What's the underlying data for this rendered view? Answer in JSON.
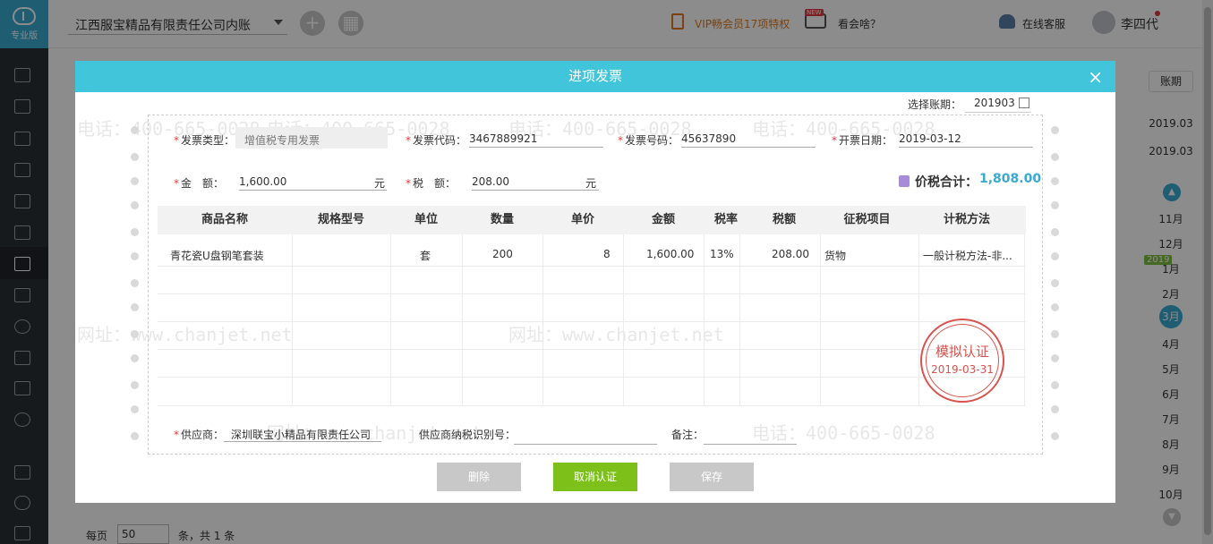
{
  "sidebar": {
    "logo_label": "专业版"
  },
  "header": {
    "company": "江西服宝精品有限责任公司内账",
    "vip": "VIP畅会员17项特权",
    "tv_badge": "NEW",
    "whats_on": "看会啥？",
    "service": "在线客服",
    "user": "李四代"
  },
  "period": {
    "title": "账期",
    "dates": [
      "2019.03",
      "2019.03"
    ],
    "months": [
      "11月",
      "12月",
      "1月",
      "2月",
      "3月",
      "4月",
      "5月",
      "6月",
      "7月",
      "8月",
      "9月",
      "10月"
    ],
    "year": "2019",
    "current_month": "3月"
  },
  "pager": {
    "per_page_label": "每页",
    "per_page": "50",
    "total": "条，共 1 条"
  },
  "watermark": {
    "phone": "电话：400-665-0028",
    "site": "网址：www.chanjet.net"
  },
  "modal": {
    "title": "进项发票",
    "close": "×",
    "account_period_label": "选择账期：",
    "account_period": "201903",
    "fields": {
      "invoice_type_label": "发票类型：",
      "invoice_type": "增值税专用发票",
      "invoice_code_label": "发票代码：",
      "invoice_code": "3467889921",
      "invoice_no_label": "发票号码：",
      "invoice_no": "45637890",
      "issue_date_label": "开票日期：",
      "issue_date": "2019-03-12",
      "amount_label": "金　额：",
      "amount": "1,600.00",
      "tax_label": "税　额：",
      "tax": "208.00",
      "unit": "元",
      "total_label": "价税合计：",
      "total": "1,808.00"
    },
    "table": {
      "headers": [
        "商品名称",
        "规格型号",
        "单位",
        "数量",
        "单价",
        "金额",
        "税率",
        "税额",
        "征税项目",
        "计税方法"
      ],
      "rows": [
        [
          "青花瓷U盘钢笔套装",
          "",
          "套",
          "200",
          "8",
          "1,600.00",
          "13%",
          "208.00",
          "货物",
          "一般计税方法-非..."
        ]
      ]
    },
    "stamp": {
      "text": "模拟认证",
      "date": "2019-03-31"
    },
    "supplier_label": "供应商：",
    "supplier": "深圳联宝小精品有限责任公司",
    "supplier_tax_label": "供应商纳税识别号：",
    "supplier_tax": "",
    "remark_label": "备注：",
    "remark": "",
    "buttons": {
      "delete": "删除",
      "cancel_cert": "取消认证",
      "save": "保存"
    }
  },
  "colors": {
    "header": "#40c5da",
    "accent": "#3aa9d1",
    "green": "#7cc019",
    "stamp": "#d9534f"
  }
}
